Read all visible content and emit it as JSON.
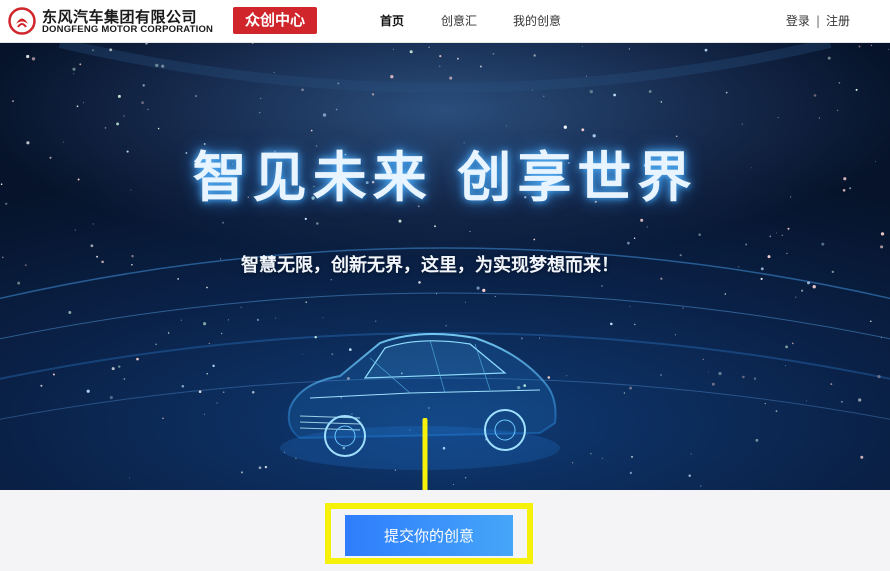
{
  "header": {
    "brand_cn": "东风汽车集团有限公司",
    "brand_en": "DONGFENG MOTOR CORPORATION",
    "badge": "众创中心",
    "nav": [
      {
        "label": "首页",
        "active": true
      },
      {
        "label": "创意汇",
        "active": false
      },
      {
        "label": "我的创意",
        "active": false
      }
    ],
    "login": "登录",
    "separator": "|",
    "register": "注册"
  },
  "hero": {
    "title": "智见未来 创享世界",
    "subtitle": "智慧无限，创新无界，这里，为实现梦想而来！"
  },
  "cta": {
    "submit_label": "提交你的创意"
  },
  "colors": {
    "brand_red": "#d0262b",
    "button_blue": "#2f7dfd",
    "highlight_yellow": "#f5f10a"
  }
}
